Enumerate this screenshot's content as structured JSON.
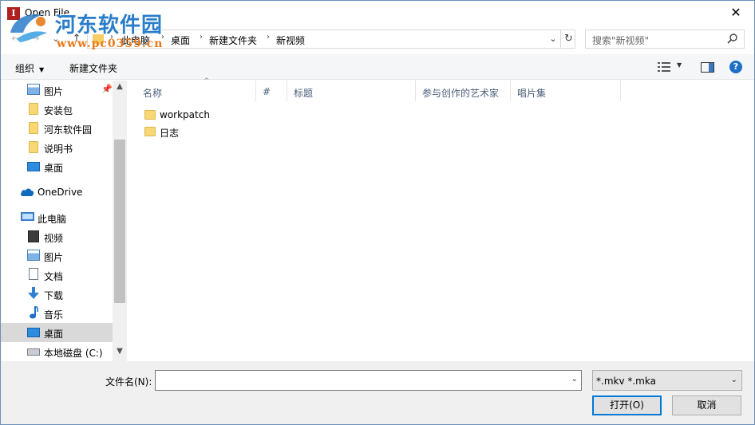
{
  "window": {
    "title": "Open File",
    "close_glyph": "✕"
  },
  "watermark": {
    "name": "河东软件园",
    "url": "www.pc0359.cn"
  },
  "nav_buttons": {
    "back": "←",
    "forward": "→",
    "dropdown": "⌄",
    "up": "↑"
  },
  "address": {
    "crumbs": [
      "此电脑",
      "桌面",
      "新建文件夹",
      "新视频"
    ],
    "separator": "›",
    "dropdown_glyph": "⌄",
    "refresh_glyph": "↻"
  },
  "search": {
    "placeholder": "搜索\"新视频\""
  },
  "toolbar": {
    "organize": "组织",
    "organize_caret": "▼",
    "new_folder": "新建文件夹",
    "view_caret": "▼",
    "help": "?"
  },
  "sidebar": {
    "items": [
      {
        "label": "图片",
        "icon": "pictures-icon",
        "pinned": true
      },
      {
        "label": "安装包",
        "icon": "folder-icon"
      },
      {
        "label": "河东软件园",
        "icon": "folder-icon"
      },
      {
        "label": "说明书",
        "icon": "folder-icon"
      },
      {
        "label": "桌面",
        "icon": "desktop-icon"
      },
      {
        "label": "OneDrive",
        "icon": "onedrive-icon"
      },
      {
        "label": "此电脑",
        "icon": "this-pc-icon"
      },
      {
        "label": "视频",
        "icon": "videos-icon"
      },
      {
        "label": "图片",
        "icon": "pictures-icon"
      },
      {
        "label": "文档",
        "icon": "documents-icon"
      },
      {
        "label": "下载",
        "icon": "downloads-icon"
      },
      {
        "label": "音乐",
        "icon": "music-icon"
      },
      {
        "label": "桌面",
        "icon": "desktop-icon",
        "selected": true
      },
      {
        "label": "本地磁盘 (C:)",
        "icon": "local-disk-icon"
      }
    ],
    "scroll_up": "▲",
    "scroll_down": "▼"
  },
  "filelist": {
    "columns": [
      "名称",
      "#",
      "标题",
      "参与创作的艺术家",
      "唱片集"
    ],
    "sort_glyph": "^",
    "files": [
      {
        "name": "workpatch",
        "type": "folder"
      },
      {
        "name": "日志",
        "type": "folder"
      }
    ]
  },
  "bottom": {
    "filename_label": "文件名(N):",
    "filename_value": "",
    "filename_caret": "⌄",
    "filter": "*.mkv *.mka",
    "filter_caret": "⌄",
    "open_button": "打开(O)",
    "cancel_button": "取消"
  },
  "colors": {
    "accent": "#0078d7",
    "folder": "#f8d775",
    "selected": "#d9d9d9",
    "watermark_blue": "#2a7dc9",
    "watermark_orange": "#e87b1c"
  }
}
